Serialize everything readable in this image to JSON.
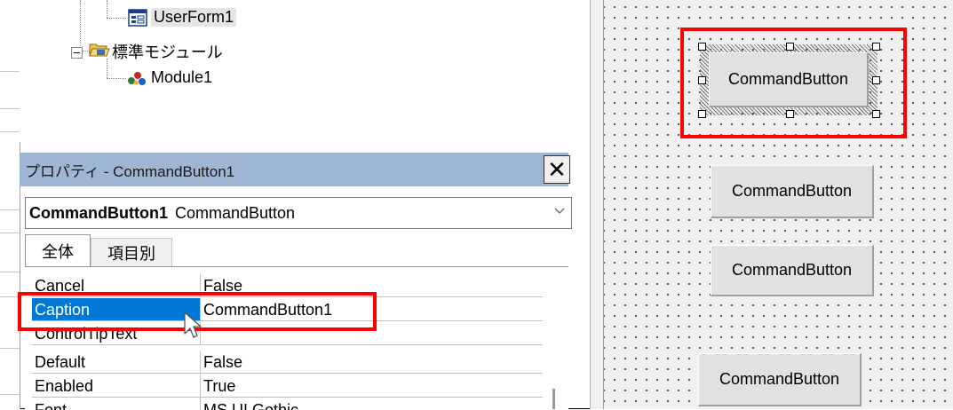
{
  "project_tree": {
    "userform_label": "UserForm1",
    "module_folder_label": "標準モジュール",
    "module_label": "Module1"
  },
  "properties_window": {
    "title": "プロパティ - CommandButton1",
    "close_label": "✕",
    "object_name": "CommandButton1",
    "object_type": "CommandButton",
    "tabs": [
      "全体",
      "項目別"
    ],
    "rows": [
      {
        "name": "Cancel",
        "value": "False"
      },
      {
        "name": "Caption",
        "value": "CommandButton1"
      },
      {
        "name": "ControlTipText",
        "value": ""
      },
      {
        "name": "Default",
        "value": "False"
      },
      {
        "name": "Enabled",
        "value": "True"
      },
      {
        "name": "Font",
        "value": "MS UI Gothic"
      }
    ],
    "selected_row": "Caption"
  },
  "designer": {
    "buttons": [
      "CommandButton",
      "CommandButton",
      "CommandButton",
      "CommandButton"
    ]
  },
  "colors": {
    "highlight": "#ff0000",
    "title_bar": "#9fb5d4",
    "selection": "#0078d7"
  }
}
